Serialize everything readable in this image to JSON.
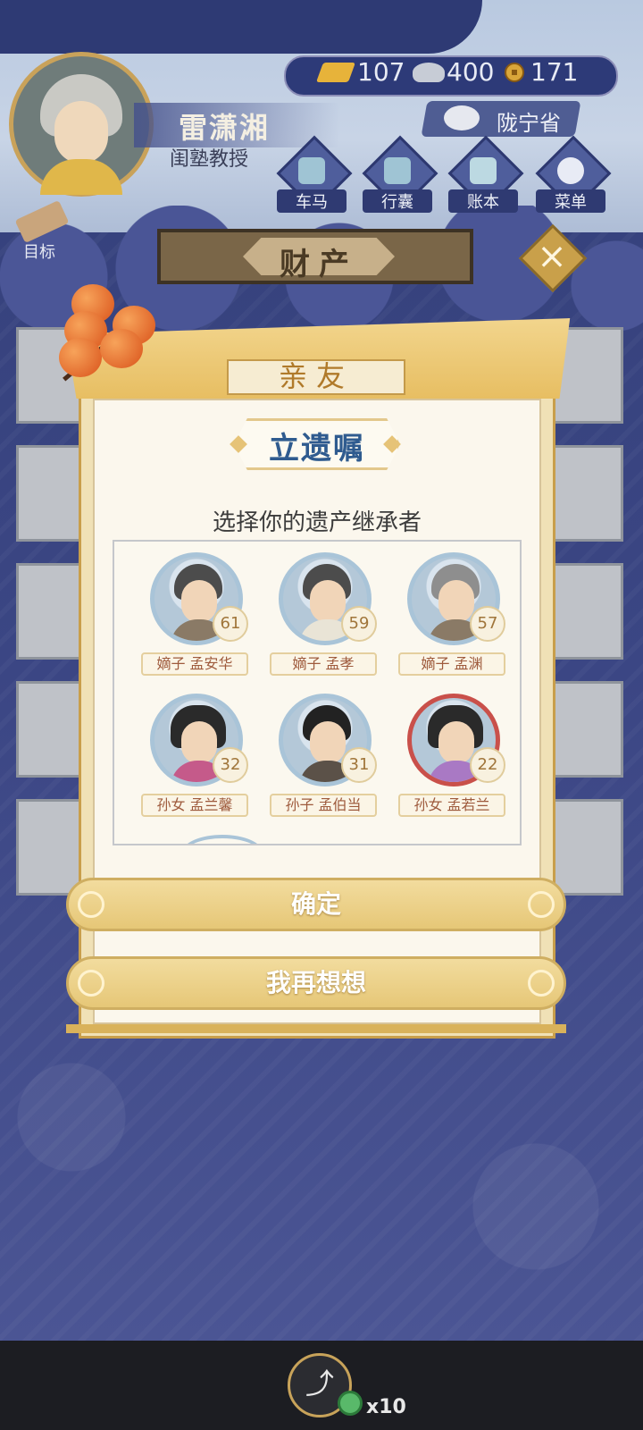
{
  "player": {
    "name": "雷潇湘",
    "title": "闺塾教授"
  },
  "currency": {
    "gold": "107",
    "silver": "400",
    "coins": "171"
  },
  "location": "陇宁省",
  "menu": [
    {
      "label": "车马",
      "icon": "carriage-icon"
    },
    {
      "label": "行囊",
      "icon": "bag-icon"
    },
    {
      "label": "账本",
      "icon": "ledger-icon"
    },
    {
      "label": "菜单",
      "icon": "more-icon"
    }
  ],
  "goal_label": "目标",
  "property_banner": "财产",
  "dialog": {
    "header": "亲友",
    "title": "立遗嘱",
    "subtitle": "选择你的遗产继承者",
    "heirs": [
      {
        "relation": "嫡子",
        "name": "孟安华",
        "label": "嫡子 孟安华",
        "age": "61",
        "gender": "male",
        "selected": false
      },
      {
        "relation": "嫡子",
        "name": "孟孝",
        "label": "嫡子 孟孝",
        "age": "59",
        "gender": "male",
        "selected": false
      },
      {
        "relation": "嫡子",
        "name": "孟渊",
        "label": "嫡子 孟渊",
        "age": "57",
        "gender": "male",
        "selected": false
      },
      {
        "relation": "孙女",
        "name": "孟兰馨",
        "label": "孙女 孟兰馨",
        "age": "32",
        "gender": "female",
        "selected": false
      },
      {
        "relation": "孙子",
        "name": "孟伯当",
        "label": "孙子 孟伯当",
        "age": "31",
        "gender": "male",
        "selected": false
      },
      {
        "relation": "孙女",
        "name": "孟若兰",
        "label": "孙女 孟若兰",
        "age": "22",
        "gender": "female",
        "selected": true
      }
    ],
    "confirm_label": "确定",
    "cancel_label": "我再想想"
  },
  "share": {
    "count": "x10"
  },
  "colors": {
    "background": "#3a447c",
    "gold_accent": "#e6c777",
    "title_blue": "#2f5b8f",
    "selected_border": "#c9504a"
  }
}
